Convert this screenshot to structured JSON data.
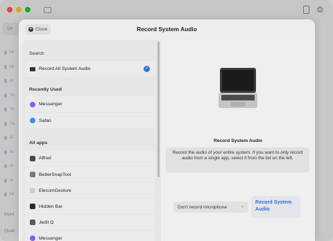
{
  "background": {
    "search_placeholder": "Se",
    "list_labels": [
      "Mi",
      "Mi",
      "Al",
      "Yo",
      "Yo",
      "Sa",
      "Al",
      "Al",
      "Al",
      "Al",
      "Mi"
    ],
    "bottom_labels": [
      "Input",
      "Quali"
    ]
  },
  "modal": {
    "close_label": "Close",
    "title": "Record System Audio"
  },
  "left": {
    "search_label": "Search",
    "system_audio_item": "Record All System Audio",
    "recently_used_header": "Recently Used",
    "recently_used": [
      {
        "label": "Messenger",
        "icon": "messenger-icon",
        "color": "#8b5cf6"
      },
      {
        "label": "Safari",
        "icon": "safari-icon",
        "color": "#3b8fe0"
      }
    ],
    "all_apps_header": "All apps",
    "all_apps": [
      {
        "label": "Alfred",
        "icon": "alfred-icon",
        "color": "#4a4a4a"
      },
      {
        "label": "BetterSnapTool",
        "icon": "bettersnaptool-icon",
        "color": "#7a7a7a"
      },
      {
        "label": "ElecomGesture",
        "icon": "elecomgesture-icon",
        "color": "#c9d4d8"
      },
      {
        "label": "Hidden Bar",
        "icon": "hidden-bar-icon",
        "color": "#2a2a2a"
      },
      {
        "label": "Jedit Ω",
        "icon": "jedit-icon",
        "color": "#5a5a5a"
      },
      {
        "label": "Messenger",
        "icon": "messenger-icon",
        "color": "#8b5cf6"
      }
    ]
  },
  "right": {
    "title": "Record System Audio",
    "description": "Record the audio of your entire system. If you want to only record audio from a single app, select it from the list on the left.",
    "mic_select_value": "Don't record microphone",
    "record_button": "Record System Audio"
  },
  "colors": {
    "accent": "#2f74d6",
    "traffic_red": "#e0443e",
    "traffic_yellow": "#dea123",
    "traffic_green": "#1aab29"
  }
}
